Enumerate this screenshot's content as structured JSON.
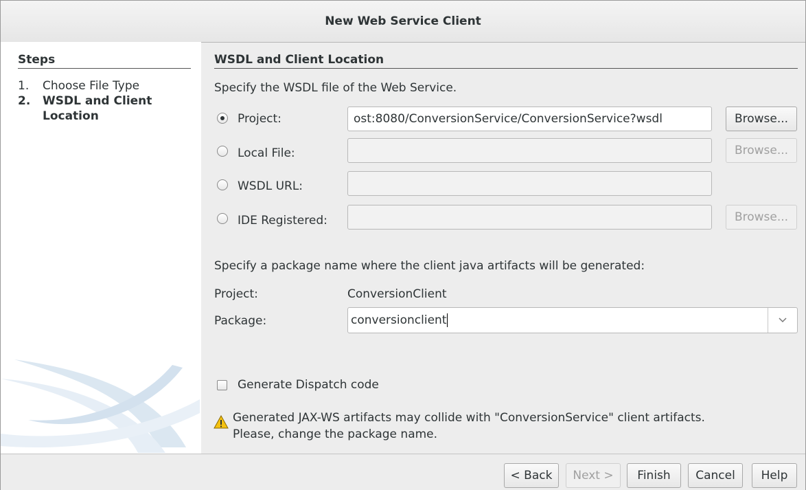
{
  "window": {
    "title": "New Web Service Client"
  },
  "steps": {
    "heading": "Steps",
    "items": [
      {
        "number": "1.",
        "label": "Choose File Type"
      },
      {
        "number": "2.",
        "label": "WSDL and Client Location"
      }
    ]
  },
  "main": {
    "heading": "WSDL and Client Location",
    "wsdl_instruction": "Specify the WSDL file of the Web Service.",
    "options": {
      "project": {
        "label": "Project:",
        "value": "ost:8080/ConversionService/ConversionService?wsdl",
        "selected": true,
        "browse_label": "Browse..."
      },
      "local_file": {
        "label": "Local File:",
        "value": "",
        "selected": false,
        "browse_label": "Browse..."
      },
      "wsdl_url": {
        "label": "WSDL URL:",
        "value": "",
        "selected": false
      },
      "ide_registered": {
        "label": "IDE Registered:",
        "value": "",
        "selected": false,
        "browse_label": "Browse..."
      }
    },
    "package_instruction": "Specify a package name where the client java artifacts will be generated:",
    "project_label": "Project:",
    "project_value": "ConversionClient",
    "package_label": "Package:",
    "package_value": "conversionclient",
    "dispatch_label": "Generate Dispatch code",
    "dispatch_checked": false,
    "warning_line1": "Generated JAX-WS artifacts may collide with \"ConversionService\" client artifacts.",
    "warning_line2": "Please, change the package name."
  },
  "footer": {
    "back": "< Back",
    "next": "Next >",
    "finish": "Finish",
    "cancel": "Cancel",
    "help": "Help"
  },
  "colors": {
    "warning": "#f5c211",
    "panel": "#ffffff",
    "background": "#ededed"
  },
  "icons": {
    "warning": "warning-triangle-icon",
    "dropdown": "chevron-down-icon"
  }
}
